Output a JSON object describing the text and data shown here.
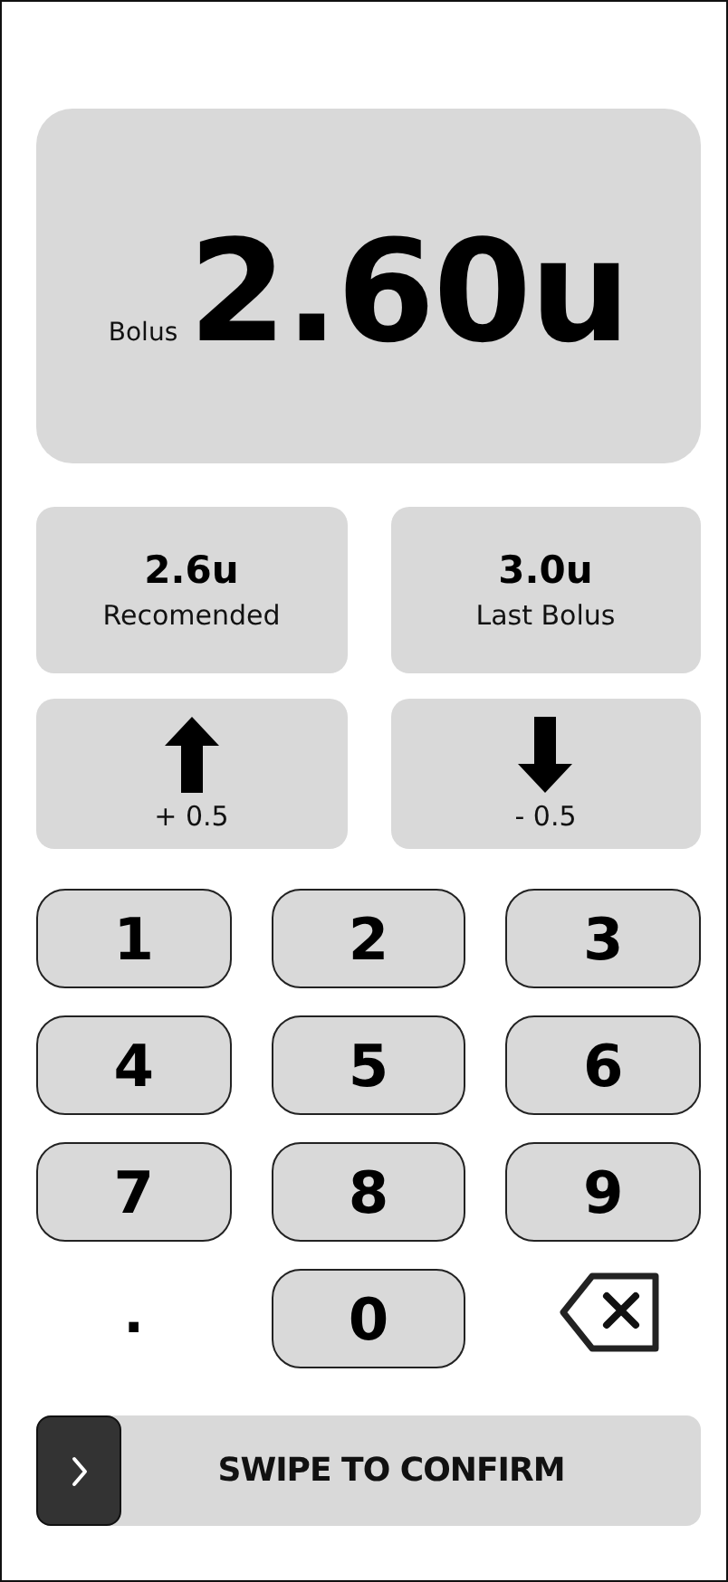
{
  "bolus": {
    "label": "Bolus",
    "value": "2.60u"
  },
  "stats": [
    {
      "value": "2.6u",
      "label": "Recomended"
    },
    {
      "value": "3.0u",
      "label": "Last Bolus"
    }
  ],
  "adjust": [
    {
      "kind": "up",
      "label": "+ 0.5"
    },
    {
      "kind": "down",
      "label": "- 0.5"
    }
  ],
  "keys": [
    {
      "kind": "digit",
      "label": "1"
    },
    {
      "kind": "digit",
      "label": "2"
    },
    {
      "kind": "digit",
      "label": "3"
    },
    {
      "kind": "digit",
      "label": "4"
    },
    {
      "kind": "digit",
      "label": "5"
    },
    {
      "kind": "digit",
      "label": "6"
    },
    {
      "kind": "digit",
      "label": "7"
    },
    {
      "kind": "digit",
      "label": "8"
    },
    {
      "kind": "digit",
      "label": "9"
    },
    {
      "kind": "dot",
      "label": "."
    },
    {
      "kind": "digit",
      "label": "0"
    },
    {
      "kind": "backspace"
    }
  ],
  "swipe": {
    "label": "SWIPE TO CONFIRM"
  }
}
